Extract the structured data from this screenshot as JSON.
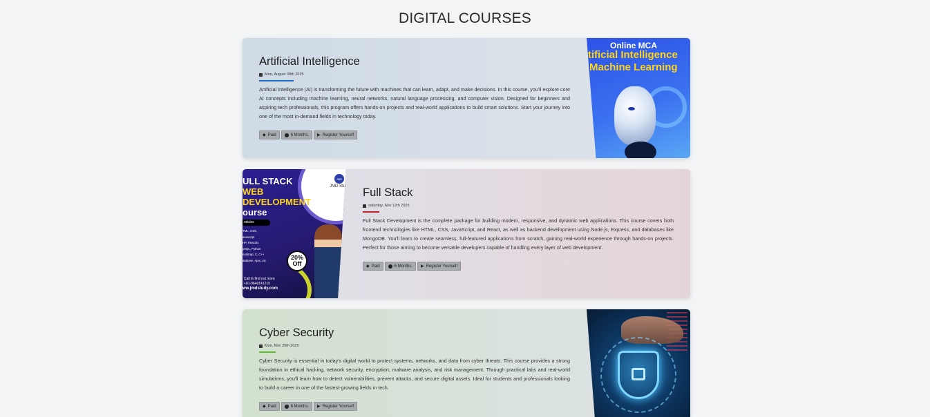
{
  "page": {
    "title": "DIGITAL COURSES"
  },
  "courses": [
    {
      "title": "Artificial Intelligence",
      "date": "Mon, August 28th 2025",
      "underline_color": "#1769c7",
      "description": "Artificial Intelligence (AI) is transforming the future with machines that can learn, adapt, and make decisions. In this course, you'll explore core AI concepts including machine learning, neural networks, natural language processing, and computer vision. Designed for beginners and aspiring tech professionals, this program offers hands-on projects and real-world applications to build smart solutions. Start your journey into one of the most in-demand fields in technology today.",
      "tags": {
        "price": "Paid",
        "duration": "6 Months.",
        "register": "Register Yourself"
      },
      "image": {
        "line1": "Online MCA",
        "line2": "rtificial Intelligence",
        "line3": "Machine Learning"
      }
    },
    {
      "title": "Full Stack",
      "date": "saturday, Nov 12th 2025",
      "underline_color": "#c0232b",
      "description": "Full Stack Development is the complete package for building modern, responsive, and dynamic web applications. This course covers both frontend technologies like HTML, CSS, JavaScript, and React, as well as backend development using Node.js, Express, and databases like MongoDB. You'll learn to create seamless, full-featured applications from scratch, gaining real-world experience through hands-on projects. Perfect for those aiming to become versatile developers capable of handling every layer of web development.",
      "tags": {
        "price": "Paid",
        "duration": "6 Months.",
        "register": "Register Yourself"
      },
      "image": {
        "line1": "ULL STACK",
        "line2": "WEB",
        "line3": "DEVELOPMENT",
        "line4": "ourse",
        "modules": "odules",
        "module_list": "TML, CSS,\navascript\nHP, ReactJs\nySQL, Python\nootstrap, C, C++\natabase, Ajax, etc",
        "brand": "JMD Stu",
        "logo": "JMD",
        "discount_pct": "20%",
        "discount_label": "Off",
        "contact_label": "Call to find out more",
        "phone": "+91-9649141215",
        "website": "ww.jmdstudy.com"
      }
    },
    {
      "title": "Cyber Security",
      "date": "Mon, Nov 25th 2025",
      "underline_color": "#5bbf2a",
      "description": "Cyber Security is essential in today's digital world to protect systems, networks, and data from cyber threats. This course provides a strong foundation in ethical hacking, network security, encryption, malware analysis, and risk management. Through practical labs and real-world simulations, you'll learn how to detect vulnerabilities, prevent attacks, and secure digital assets. Ideal for students and professionals looking to build a career in one of the fastest-growing fields in tech.",
      "tags": {
        "price": "Paid",
        "duration": "6 Months.",
        "register": "Register Yourself"
      }
    }
  ]
}
